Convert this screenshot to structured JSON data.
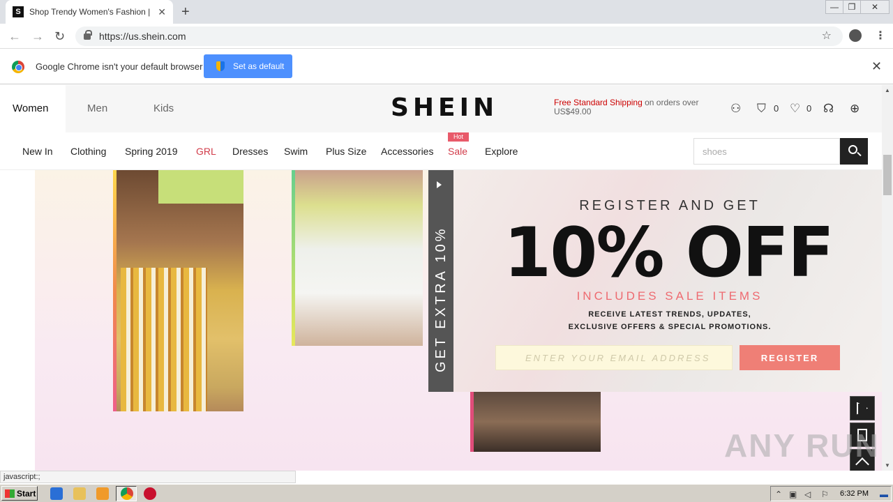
{
  "browser": {
    "tab_title": "Shop Trendy Women's Fashion | SHE",
    "favicon_letter": "S",
    "url": "https://us.shein.com",
    "infobar_text": "Google Chrome isn't your default browser",
    "set_default_label": "Set as default"
  },
  "header": {
    "categories": [
      "Women",
      "Men",
      "Kids"
    ],
    "logo": "SHEIN",
    "shipping_highlight": "Free Standard Shipping",
    "shipping_rest": "on orders over US$49.00",
    "bag_count": "0",
    "wishlist_count": "0"
  },
  "nav": {
    "items": [
      "New In",
      "Clothing",
      "Spring 2019",
      "GRL",
      "Dresses",
      "Swim",
      "Plus Size",
      "Accessories",
      "Sale",
      "Explore"
    ],
    "hot_badge": "Hot",
    "search_placeholder": "shoes"
  },
  "promo": {
    "side_tab": "GET EXTRA 10%",
    "title": "REGISTER AND GET",
    "big": "10% OFF",
    "subtitle": "INCLUDES SALE ITEMS",
    "desc_line1": "RECEIVE LATEST TRENDS, UPDATES,",
    "desc_line2": "EXCLUSIVE OFFERS & SPECIAL PROMOTIONS.",
    "email_placeholder": "ENTER YOUR EMAIL ADDRESS",
    "register_label": "REGISTER"
  },
  "status_bar": "javascript:;",
  "watermark": "ANY RUN",
  "taskbar": {
    "start_label": "Start",
    "clock": "6:32 PM"
  },
  "colors": {
    "sale_red": "#d23c4a",
    "register": "#ef7f76",
    "chrome_blue": "#4d90fe"
  }
}
